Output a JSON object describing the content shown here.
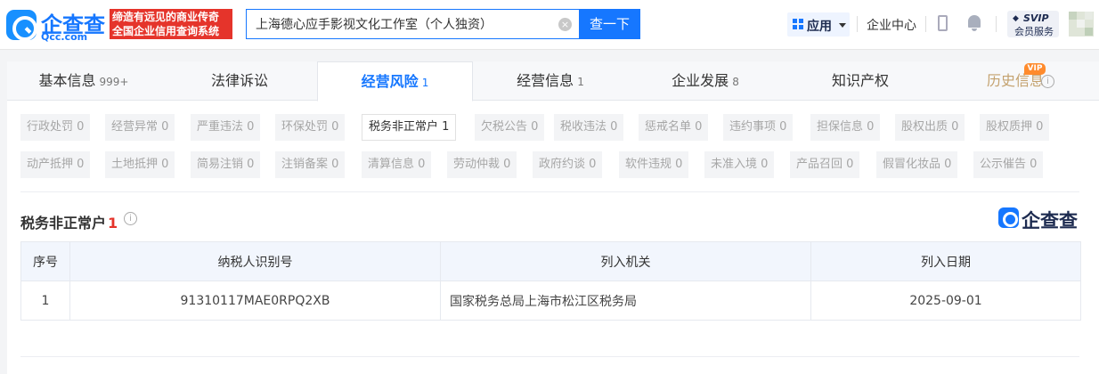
{
  "header": {
    "logo_name": "企查查",
    "logo_domain": "Qcc.com",
    "slogan_line1": "缔造有远见的商业传奇",
    "slogan_line2": "全国企业信用查询系统",
    "search_value": "上海德心应手影视文化工作室（个人独资）",
    "search_button": "查一下",
    "apps_label": "应用",
    "enterprise_center": "企业中心",
    "svip_title": "SVIP",
    "svip_subtitle": "会员服务",
    "brand_color": "#1677ff"
  },
  "tabs": [
    {
      "label": "基本信息",
      "count": "999+"
    },
    {
      "label": "法律诉讼",
      "count": ""
    },
    {
      "label": "经营风险",
      "count": "1"
    },
    {
      "label": "经营信息",
      "count": "1"
    },
    {
      "label": "企业发展",
      "count": "8"
    },
    {
      "label": "知识产权",
      "count": ""
    },
    {
      "label": "历史信息",
      "count": "",
      "badge": "VIP"
    }
  ],
  "filters": [
    "行政处罚 0",
    "经营异常 0",
    "严重违法 0",
    "环保处罚 0",
    "税务非正常户 1",
    "欠税公告 0",
    "税收违法 0",
    "惩戒名单 0",
    "违约事项 0",
    "担保信息 0",
    "股权出质 0",
    "股权质押 0",
    "动产抵押 0",
    "土地抵押 0",
    "简易注销 0",
    "注销备案 0",
    "清算信息 0",
    "劳动仲裁 0",
    "政府约谈 0",
    "软件违规 0",
    "未准入境 0",
    "产品召回 0",
    "假冒化妆品 0",
    "公示催告 0"
  ],
  "section": {
    "title": "税务非正常户",
    "count": "1",
    "watermark": "企查查"
  },
  "table": {
    "headers": [
      "序号",
      "纳税人识别号",
      "列入机关",
      "列入日期"
    ],
    "rows": [
      [
        "1",
        "91310117MAE0RPQ2XB",
        "国家税务总局上海市松江区税务局",
        "2025-09-01"
      ]
    ]
  }
}
